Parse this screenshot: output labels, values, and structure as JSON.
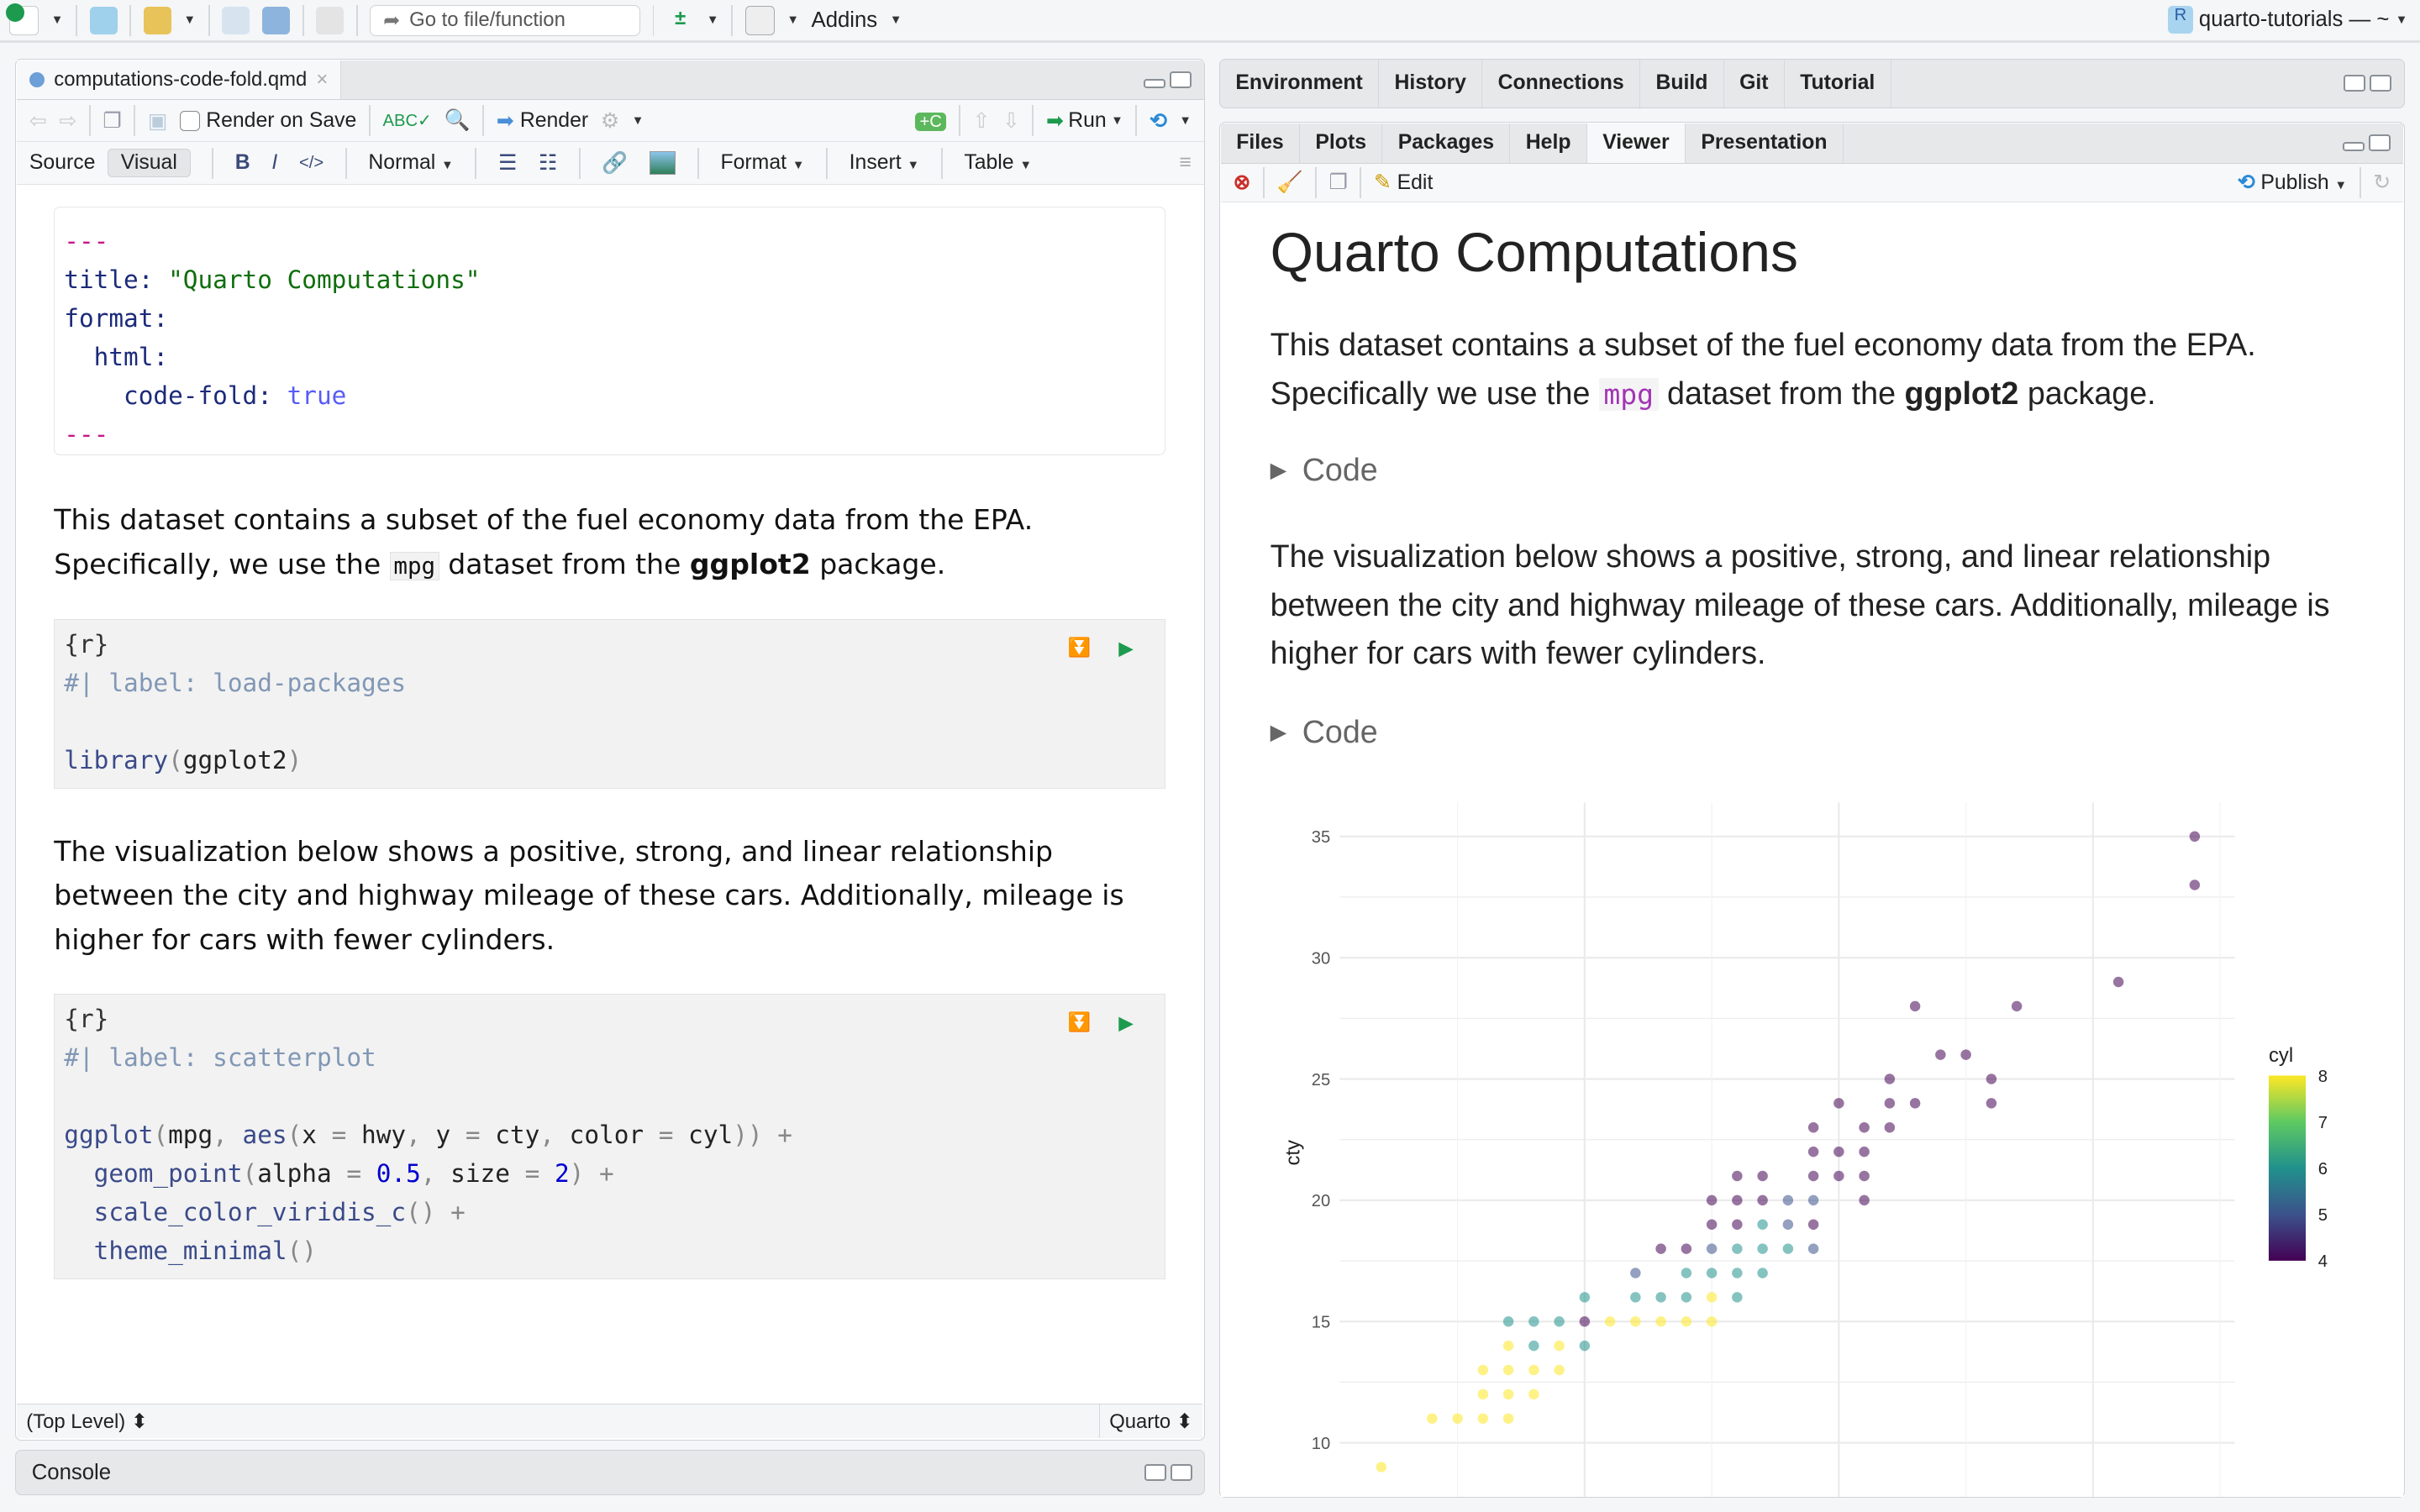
{
  "topbar": {
    "goto_placeholder": "Go to file/function",
    "addins": "Addins",
    "project": "quarto-tutorials — ~"
  },
  "source": {
    "tab": "computations-code-fold.qmd",
    "render_on_save": "Render on Save",
    "render": "Render",
    "run": "Run",
    "source_btn": "Source",
    "visual_btn": "Visual",
    "style": "Normal",
    "format": "Format",
    "insert": "Insert",
    "table": "Table",
    "yaml": [
      [
        {
          "t": "---",
          "k": "dash"
        }
      ],
      [
        {
          "t": "title: ",
          "k": "key"
        },
        {
          "t": "\"Quarto Computations\"",
          "k": "str"
        }
      ],
      [
        {
          "t": "format:",
          "k": "key"
        }
      ],
      [
        {
          "t": "  html:",
          "k": "key"
        }
      ],
      [
        {
          "t": "    code-fold: ",
          "k": "key"
        },
        {
          "t": "true",
          "k": "bool"
        }
      ],
      [
        {
          "t": "---",
          "k": "dash"
        }
      ]
    ],
    "para1": {
      "a": "This dataset contains a subset of the fuel economy data from the EPA. Specifically, we use the ",
      "code": "mpg",
      "b": " dataset from the ",
      "bold": "ggplot2",
      "c": " package."
    },
    "chunk1": [
      [
        {
          "t": "{r}",
          "k": "chunk"
        }
      ],
      [
        {
          "t": "#| label: load-packages",
          "k": "cm"
        }
      ],
      [
        {
          "t": " ",
          "k": "plain"
        }
      ],
      [
        {
          "t": "library",
          "k": "fn"
        },
        {
          "t": "(",
          "k": "op"
        },
        {
          "t": "ggplot2",
          "k": "plain"
        },
        {
          "t": ")",
          "k": "op"
        }
      ]
    ],
    "para2": "The visualization below shows a positive, strong, and linear relationship between the city and highway mileage of these cars. Additionally, mileage is higher for cars with fewer cylinders.",
    "chunk2": [
      [
        {
          "t": "{r}",
          "k": "chunk"
        }
      ],
      [
        {
          "t": "#| label: scatterplot",
          "k": "cm"
        }
      ],
      [
        {
          "t": " ",
          "k": "plain"
        }
      ],
      [
        {
          "t": "ggplot",
          "k": "fn"
        },
        {
          "t": "(",
          "k": "op"
        },
        {
          "t": "mpg",
          "k": "plain"
        },
        {
          "t": ", ",
          "k": "op"
        },
        {
          "t": "aes",
          "k": "fn"
        },
        {
          "t": "(",
          "k": "op"
        },
        {
          "t": "x",
          "k": "plain"
        },
        {
          "t": " = ",
          "k": "op"
        },
        {
          "t": "hwy",
          "k": "plain"
        },
        {
          "t": ", ",
          "k": "op"
        },
        {
          "t": "y",
          "k": "plain"
        },
        {
          "t": " = ",
          "k": "op"
        },
        {
          "t": "cty",
          "k": "plain"
        },
        {
          "t": ", ",
          "k": "op"
        },
        {
          "t": "color",
          "k": "plain"
        },
        {
          "t": " = ",
          "k": "op"
        },
        {
          "t": "cyl",
          "k": "plain"
        },
        {
          "t": ")) +",
          "k": "op"
        }
      ],
      [
        {
          "t": "  geom_point",
          "k": "fn"
        },
        {
          "t": "(",
          "k": "op"
        },
        {
          "t": "alpha",
          "k": "plain"
        },
        {
          "t": " = ",
          "k": "op"
        },
        {
          "t": "0.5",
          "k": "num"
        },
        {
          "t": ", ",
          "k": "op"
        },
        {
          "t": "size",
          "k": "plain"
        },
        {
          "t": " = ",
          "k": "op"
        },
        {
          "t": "2",
          "k": "num"
        },
        {
          "t": ") +",
          "k": "op"
        }
      ],
      [
        {
          "t": "  scale_color_viridis_c",
          "k": "fn"
        },
        {
          "t": "() +",
          "k": "op"
        }
      ],
      [
        {
          "t": "  theme_minimal",
          "k": "fn"
        },
        {
          "t": "()",
          "k": "op"
        }
      ]
    ],
    "status_left": "(Top Level) ⬍",
    "status_right": "Quarto ⬍"
  },
  "console": {
    "label": "Console"
  },
  "top_right_tabs": [
    "Environment",
    "History",
    "Connections",
    "Build",
    "Git",
    "Tutorial"
  ],
  "viewer_tabs": [
    "Files",
    "Plots",
    "Packages",
    "Help",
    "Viewer",
    "Presentation"
  ],
  "viewer_active": "Viewer",
  "viewer_toolbar": {
    "edit": "Edit",
    "publish": "Publish"
  },
  "viewer": {
    "title": "Quarto Computations",
    "p1": {
      "a": "This dataset contains a subset of the fuel economy data from the EPA. Specifically we use the ",
      "code": "mpg",
      "b": " dataset from the ",
      "bold": "ggplot2",
      "c": " package."
    },
    "code_toggle": "Code",
    "p2": "The visualization below shows a positive, strong, and linear relationship between the city and highway mileage of these cars. Additionally, mileage is higher for cars with fewer cylinders.",
    "code_toggle2": "Code"
  },
  "chart_data": {
    "type": "scatter",
    "ylabel": "cty",
    "xlabel": "",
    "x_variable": "hwy",
    "ylim": [
      9,
      35.5
    ],
    "xlim": [
      12,
      44
    ],
    "yticks": [
      10,
      15,
      20,
      25,
      30,
      35
    ],
    "x_major_grid": [
      20,
      30,
      40
    ],
    "x_minor_grid": [
      15,
      25,
      35,
      45
    ],
    "grid": true,
    "legend": {
      "title": "cyl",
      "ticks": [
        4,
        5,
        6,
        7,
        8
      ],
      "range": [
        4,
        8
      ],
      "placement": "right",
      "colormap": "viridis"
    },
    "alpha": 0.5,
    "points_fields": [
      "hwy",
      "cty",
      "cyl"
    ],
    "points": [
      [
        44,
        35,
        4
      ],
      [
        44,
        33,
        4
      ],
      [
        41,
        29,
        4
      ],
      [
        33,
        28,
        4
      ],
      [
        37,
        28,
        4
      ],
      [
        34,
        26,
        4
      ],
      [
        35,
        26,
        4
      ],
      [
        32,
        25,
        4
      ],
      [
        36,
        25,
        4
      ],
      [
        30,
        24,
        4
      ],
      [
        32,
        24,
        4
      ],
      [
        33,
        24,
        4
      ],
      [
        36,
        24,
        4
      ],
      [
        29,
        23,
        4
      ],
      [
        31,
        23,
        4
      ],
      [
        32,
        23,
        4
      ],
      [
        29,
        22,
        4
      ],
      [
        30,
        22,
        4
      ],
      [
        31,
        22,
        4
      ],
      [
        26,
        21,
        4
      ],
      [
        27,
        21,
        4
      ],
      [
        29,
        21,
        4
      ],
      [
        30,
        21,
        4
      ],
      [
        31,
        21,
        4
      ],
      [
        25,
        20,
        4
      ],
      [
        26,
        20,
        4
      ],
      [
        27,
        20,
        4
      ],
      [
        28,
        20,
        5
      ],
      [
        29,
        20,
        5
      ],
      [
        31,
        20,
        4
      ],
      [
        25,
        19,
        4
      ],
      [
        26,
        19,
        4
      ],
      [
        27,
        19,
        6
      ],
      [
        28,
        19,
        5
      ],
      [
        29,
        19,
        4
      ],
      [
        23,
        18,
        4
      ],
      [
        24,
        18,
        4
      ],
      [
        25,
        18,
        5
      ],
      [
        26,
        18,
        6
      ],
      [
        27,
        18,
        6
      ],
      [
        28,
        18,
        6
      ],
      [
        29,
        18,
        5
      ],
      [
        22,
        17,
        5
      ],
      [
        24,
        17,
        6
      ],
      [
        25,
        17,
        6
      ],
      [
        26,
        17,
        6
      ],
      [
        27,
        17,
        6
      ],
      [
        20,
        16,
        6
      ],
      [
        22,
        16,
        6
      ],
      [
        23,
        16,
        6
      ],
      [
        24,
        16,
        6
      ],
      [
        25,
        16,
        8
      ],
      [
        26,
        16,
        6
      ],
      [
        17,
        15,
        6
      ],
      [
        18,
        15,
        6
      ],
      [
        19,
        15,
        6
      ],
      [
        20,
        15,
        4
      ],
      [
        21,
        15,
        8
      ],
      [
        22,
        15,
        8
      ],
      [
        23,
        15,
        8
      ],
      [
        24,
        15,
        8
      ],
      [
        25,
        15,
        8
      ],
      [
        17,
        14,
        8
      ],
      [
        18,
        14,
        6
      ],
      [
        19,
        14,
        8
      ],
      [
        20,
        14,
        6
      ],
      [
        16,
        13,
        8
      ],
      [
        17,
        13,
        8
      ],
      [
        18,
        13,
        8
      ],
      [
        19,
        13,
        8
      ],
      [
        16,
        12,
        8
      ],
      [
        17,
        12,
        8
      ],
      [
        18,
        12,
        8
      ],
      [
        14,
        11,
        8
      ],
      [
        15,
        11,
        8
      ],
      [
        16,
        11,
        8
      ],
      [
        17,
        11,
        8
      ],
      [
        12,
        9,
        8
      ]
    ]
  }
}
